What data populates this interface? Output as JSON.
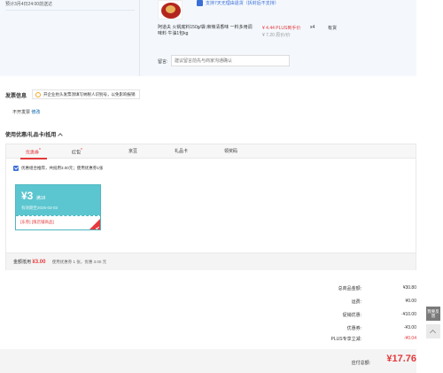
{
  "order": {
    "delivery_note": "预计3月4日24:00前送达",
    "badge_text": "支持7天无理由退货（拆封后不支持）",
    "product_title": "阿道夫 火锅底料150g/袋 麻辣清香味 一料多用调味料 牛油1包kg",
    "price": "¥ 4.44 PLUS到手价",
    "price_orig": "¥ 7.20 原价/价",
    "qty": "x4",
    "stock": "有货",
    "remark_label": "留言:",
    "remark_placeholder": "建议留言前先与商家沟通确认"
  },
  "invoice": {
    "title": "发票信息",
    "tip": "开企业抬头发票须填写纳税人识别号，以免影响报销",
    "type_text": "不开发票",
    "modify": "修改"
  },
  "coupons": {
    "title": "使用优惠/礼品卡/抵用",
    "tabs": [
      {
        "label": "优惠券",
        "star": "*"
      },
      {
        "label": "红包",
        "star": "*"
      },
      {
        "label": "京豆",
        "star": ""
      },
      {
        "label": "礼品卡",
        "star": ""
      },
      {
        "label": "领奖码",
        "star": ""
      }
    ],
    "option_text": "优惠组合推荐，共抵用3.00元；使用优惠券1张",
    "card": {
      "amount": "¥3",
      "condition": "满18",
      "date": "有效期至2025-03-03",
      "tag": "[东券] [限店铺商品]",
      "color": "#5cc6d0"
    },
    "footer_label": "金额抵用",
    "footer_amount": "¥3.00",
    "footer_note": "使用优惠券 1 张，优惠 3.00 元"
  },
  "summary": {
    "rows": [
      {
        "label": "总商品金额:",
        "value": "¥30.80",
        "red": false
      },
      {
        "label": "运费:",
        "value": "¥0.00",
        "red": false
      },
      {
        "label": "促销优惠:",
        "value": "-¥10.00",
        "red": false
      },
      {
        "label": "优惠券:",
        "value": "-¥3.00",
        "red": false
      },
      {
        "label": "PLUS专享立减:",
        "value": "-¥0.04",
        "red": true
      }
    ],
    "pay_label": "应付总额:",
    "pay_amount": "¥17.76"
  },
  "side": {
    "survey": "我要反馈"
  },
  "colors": {
    "accent_red": "#e4393c",
    "link_blue": "#005ea7",
    "top_bg": "#f4f8fd"
  }
}
